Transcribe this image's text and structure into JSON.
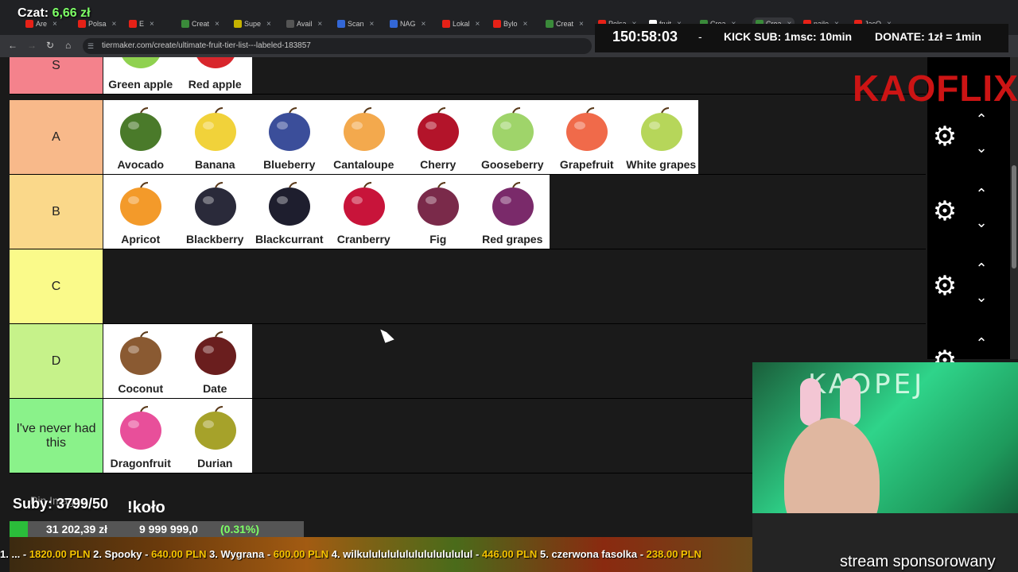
{
  "browser": {
    "tabs": [
      {
        "label": "Are",
        "color": "#e62117"
      },
      {
        "label": "Polsa",
        "color": "#e62117"
      },
      {
        "label": "E",
        "color": "#e62117"
      },
      {
        "label": "Creat",
        "color": "#3a8a3a"
      },
      {
        "label": "Supe",
        "color": "#c5b200"
      },
      {
        "label": "Avail",
        "color": "#555"
      },
      {
        "label": "Scan",
        "color": "#3367d6"
      },
      {
        "label": "NAG",
        "color": "#3367d6"
      },
      {
        "label": "Lokal",
        "color": "#e62117"
      },
      {
        "label": "Bylo",
        "color": "#e62117"
      },
      {
        "label": "Creat",
        "color": "#3a8a3a"
      },
      {
        "label": "Polsa",
        "color": "#e62117"
      },
      {
        "label": "fruit",
        "color": "#ffffff"
      },
      {
        "label": "Crea",
        "color": "#3a8a3a"
      },
      {
        "label": "Crea",
        "color": "#3a8a3a"
      },
      {
        "label": "najle",
        "color": "#e62117"
      },
      {
        "label": "JacO",
        "color": "#e62117"
      }
    ],
    "url": "tiermaker.com/create/ultimate-fruit-tier-list---labeled-183857"
  },
  "overlay": {
    "czat_label": "Czat:",
    "czat_amount": "6,66 zł",
    "timer": "150:58:03",
    "dash": "-",
    "kick": "KICK SUB: 1msc: 10min",
    "donate": "DONATE: 1zł = 1min",
    "logo": "KAOFLIX",
    "subs": "Suby: 3799/50",
    "pin": "Pin Images",
    "kolo": "!koło",
    "goal_current": "31 202,39 zł",
    "goal_max": "9 999 999,0",
    "goal_pct_text": "(0.31%)",
    "goal_fraction": 0.0031,
    "ticker": [
      {
        "label": "1. ...",
        "amount": "1820.00 PLN"
      },
      {
        "label": "2. Spooky",
        "amount": "640.00 PLN"
      },
      {
        "label": "3. Wygrana",
        "amount": "600.00 PLN"
      },
      {
        "label": "4. wilkulululululululululululul",
        "amount": "446.00 PLN"
      },
      {
        "label": "5. czerwona fasolka",
        "amount": "238.00 PLN"
      }
    ],
    "sponsor": "stream sponsorowany",
    "cam_text": "KAOPEJ"
  },
  "tiers": [
    {
      "label": "S",
      "color": "#f4828c",
      "items": [
        {
          "name": "Green apple",
          "icon": "green-apple",
          "color": "#8fd14f"
        },
        {
          "name": "Red apple",
          "icon": "red-apple",
          "color": "#d8262c"
        }
      ]
    },
    {
      "label": "A",
      "color": "#f8b98a",
      "items": [
        {
          "name": "Avocado",
          "icon": "avocado",
          "color": "#4a7a2a"
        },
        {
          "name": "Banana",
          "icon": "banana",
          "color": "#f1d23a"
        },
        {
          "name": "Blueberry",
          "icon": "blueberry",
          "color": "#3b4e9a"
        },
        {
          "name": "Cantaloupe",
          "icon": "cantaloupe",
          "color": "#f3a94d"
        },
        {
          "name": "Cherry",
          "icon": "cherry",
          "color": "#b3142a"
        },
        {
          "name": "Gooseberry",
          "icon": "gooseberry",
          "color": "#9fd46a"
        },
        {
          "name": "Grapefruit",
          "icon": "grapefruit",
          "color": "#f06a4a"
        },
        {
          "name": "White grapes",
          "icon": "white-grapes",
          "color": "#b6d65a"
        }
      ]
    },
    {
      "label": "B",
      "color": "#fad88a",
      "items": [
        {
          "name": "Apricot",
          "icon": "apricot",
          "color": "#f39a2a"
        },
        {
          "name": "Blackberry",
          "icon": "blackberry",
          "color": "#2a2a3a"
        },
        {
          "name": "Blackcurrant",
          "icon": "blackcurrant",
          "color": "#1e1e2e"
        },
        {
          "name": "Cranberry",
          "icon": "cranberry",
          "color": "#c8143a"
        },
        {
          "name": "Fig",
          "icon": "fig",
          "color": "#7a2a4a"
        },
        {
          "name": "Red grapes",
          "icon": "red-grapes",
          "color": "#7a2a6a"
        }
      ]
    },
    {
      "label": "C",
      "color": "#fafa8a",
      "items": []
    },
    {
      "label": "D",
      "color": "#c6f28a",
      "items": [
        {
          "name": "Coconut",
          "icon": "coconut",
          "color": "#8a5a32"
        },
        {
          "name": "Date",
          "icon": "date",
          "color": "#6a1e1e"
        }
      ]
    },
    {
      "label": "I've never had this",
      "color": "#8af28a",
      "items": [
        {
          "name": "Dragonfruit",
          "icon": "dragonfruit",
          "color": "#e84f9a"
        },
        {
          "name": "Durian",
          "icon": "durian",
          "color": "#a6a22a"
        }
      ]
    }
  ]
}
